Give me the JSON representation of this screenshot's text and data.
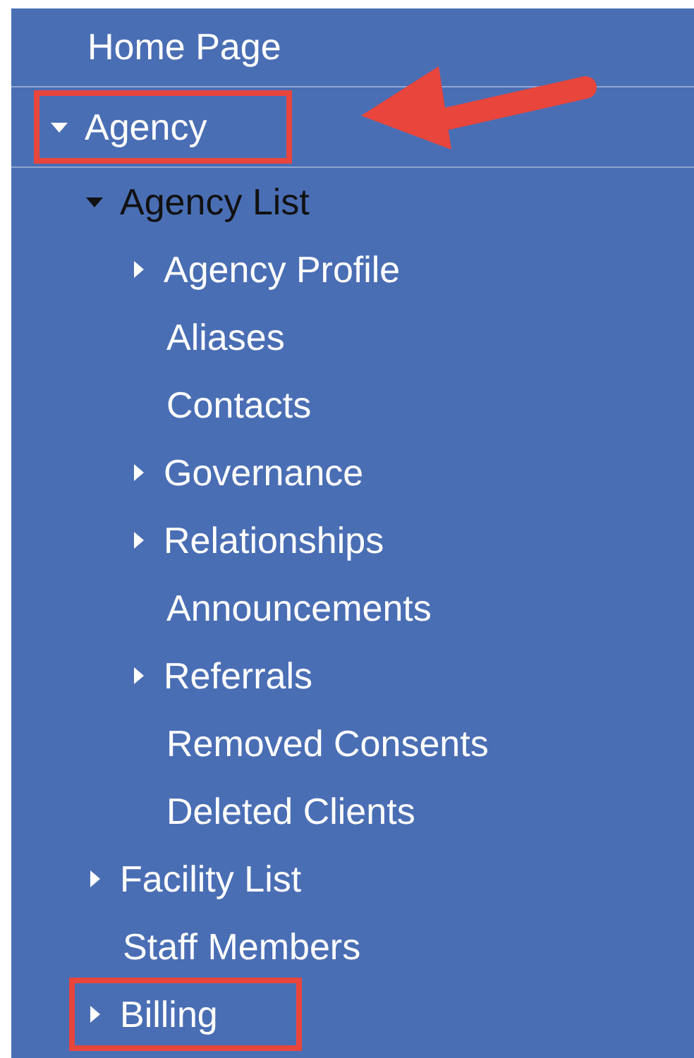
{
  "menu": [
    {
      "label": "Home Page",
      "selected": false,
      "highlighted": false
    },
    {
      "label": "Agency",
      "selected": false,
      "highlighted": true,
      "expanded": true,
      "children": [
        {
          "label": "Agency List",
          "selected": true,
          "highlighted": false,
          "expanded": true,
          "children": [
            {
              "label": "Agency Profile",
              "selected": false,
              "highlighted": false,
              "expanded": false
            },
            {
              "label": "Aliases",
              "selected": false,
              "highlighted": false
            },
            {
              "label": "Contacts",
              "selected": false,
              "highlighted": false
            },
            {
              "label": "Governance",
              "selected": false,
              "highlighted": false,
              "expanded": false
            },
            {
              "label": "Relationships",
              "selected": false,
              "highlighted": false,
              "expanded": false
            },
            {
              "label": "Announcements",
              "selected": false,
              "highlighted": false
            },
            {
              "label": "Referrals",
              "selected": false,
              "highlighted": false,
              "expanded": false
            },
            {
              "label": "Removed Consents",
              "selected": false,
              "highlighted": false
            },
            {
              "label": "Deleted Clients",
              "selected": false,
              "highlighted": false
            }
          ]
        },
        {
          "label": "Facility List",
          "selected": false,
          "highlighted": false,
          "expanded": false
        },
        {
          "label": "Staff Members",
          "selected": false,
          "highlighted": false
        },
        {
          "label": "Billing",
          "selected": false,
          "highlighted": true,
          "expanded": false
        }
      ]
    }
  ]
}
